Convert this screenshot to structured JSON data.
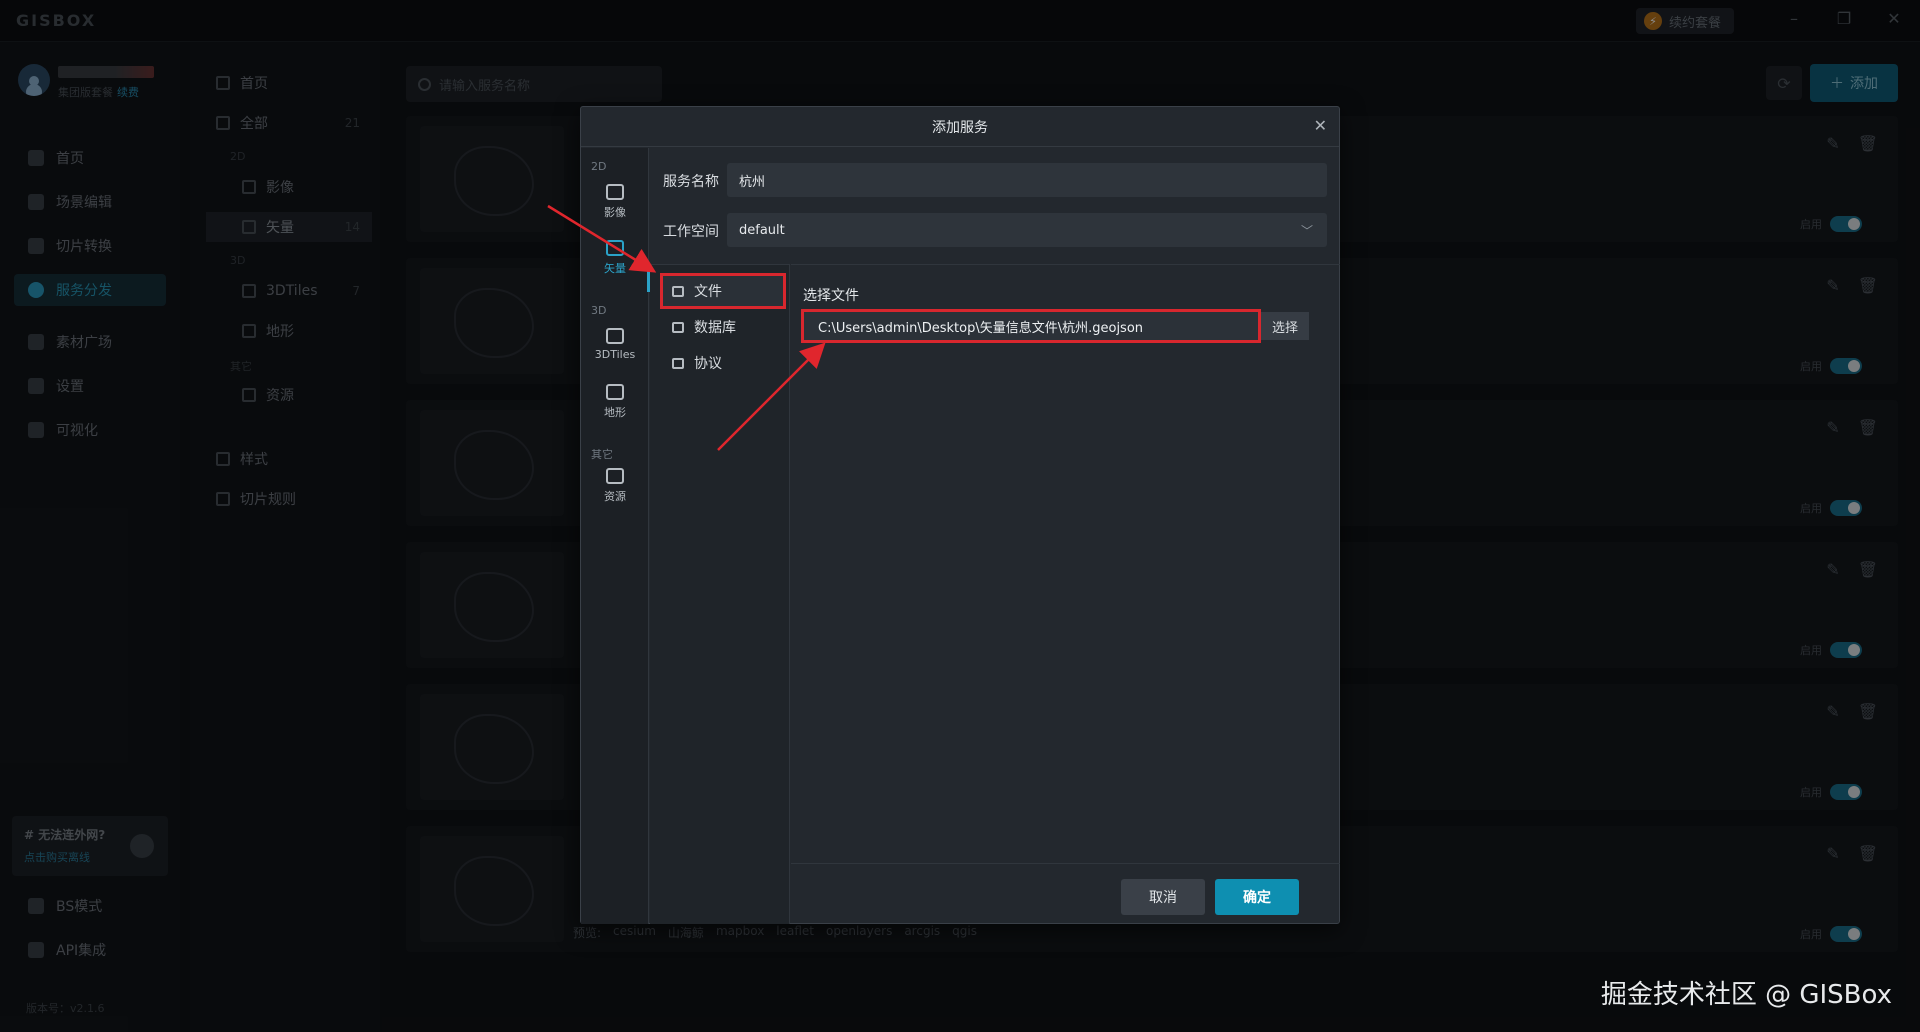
{
  "app": {
    "logo": "GISBOX",
    "renew": "续约套餐",
    "minimize": "–",
    "restore": "❐",
    "close": "✕"
  },
  "user": {
    "subtitle": "集团版套餐",
    "renew_link": "续费"
  },
  "leftnav": [
    {
      "label": "首页",
      "icon": "home-icon"
    },
    {
      "label": "场景编辑",
      "icon": "cube-icon"
    },
    {
      "label": "切片转换",
      "icon": "convert-icon"
    },
    {
      "label": "服务分发",
      "icon": "upload-icon",
      "active": true
    },
    {
      "label": "素材广场",
      "icon": "image-icon"
    },
    {
      "label": "设置",
      "icon": "gear-icon"
    },
    {
      "label": "可视化",
      "icon": "chart-icon"
    }
  ],
  "promo": {
    "title": "# 无法连外网?",
    "link": "点击购买离线"
  },
  "bottomnav": [
    {
      "label": "BS模式",
      "icon": "code-icon"
    },
    {
      "label": "API集成",
      "icon": "api-icon"
    }
  ],
  "version": "版本号：v2.1.6",
  "subnav": {
    "home": "首页",
    "all": {
      "label": "全部",
      "count": "21"
    },
    "sect_2d": "2D",
    "imagery": "影像",
    "vector": {
      "label": "矢量",
      "count": "14"
    },
    "sect_3d": "3D",
    "tiles3d": {
      "label": "3DTiles",
      "count": "7"
    },
    "terrain": "地形",
    "sect_other": "其它",
    "resource": "资源",
    "style": "样式",
    "tile_rules": "切片规则"
  },
  "main": {
    "search_placeholder": "请输入服务名称",
    "add_label": "添加",
    "enable_label": "启用",
    "preview_label": "预览:",
    "preview_links": [
      "cesium",
      "山海鲸",
      "mapbox",
      "leaflet",
      "openlayers",
      "arcgis",
      "qgis"
    ]
  },
  "modal": {
    "title": "添加服务",
    "close": "✕",
    "typebar": {
      "sect_2d": "2D",
      "sect_3d": "3D",
      "sect_other": "其它",
      "items": [
        "影像",
        "矢量",
        "3DTiles",
        "地形",
        "资源"
      ]
    },
    "service_name_label": "服务名称",
    "service_name_value": "杭州",
    "workspace_label": "工作空间",
    "workspace_value": "default",
    "sources": [
      "文件",
      "数据库",
      "协议"
    ],
    "file_title": "选择文件",
    "file_path": "C:\\Users\\admin\\Desktop\\矢量信息文件\\杭州.geojson",
    "choose_label": "选择",
    "cancel_label": "取消",
    "ok_label": "确定"
  },
  "watermark": "掘金技术社区 @ GISBox",
  "colors": {
    "accent": "#0e8fb1",
    "highlight": "#d8272e"
  }
}
